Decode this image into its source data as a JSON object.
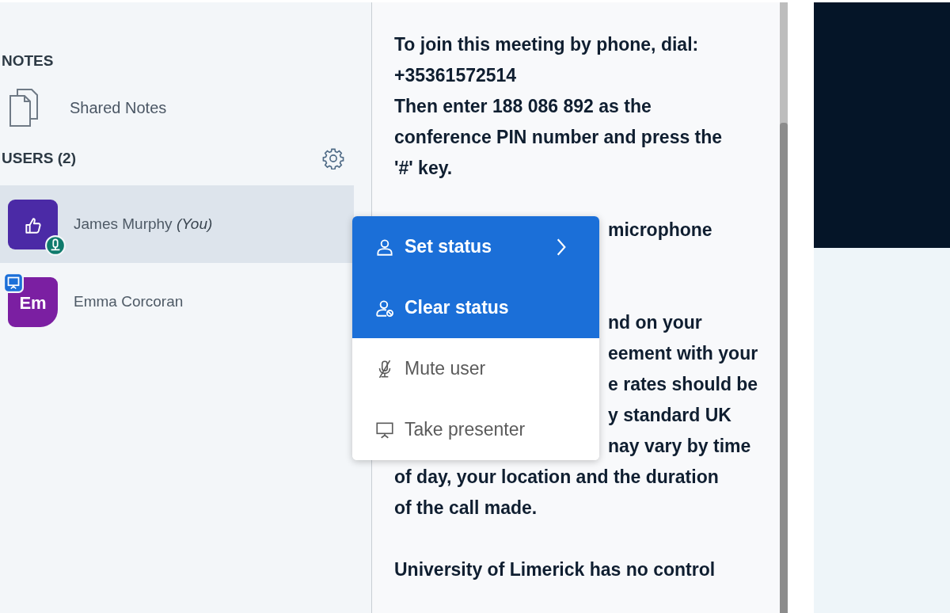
{
  "sidebar": {
    "notes": {
      "title": "NOTES",
      "items": [
        {
          "label": "Shared Notes"
        }
      ]
    },
    "users": {
      "title": "USERS (2)",
      "list": [
        {
          "name": "James Murphy",
          "suffix": "(You)",
          "selected": true,
          "avatar": {
            "kind": "status",
            "color": "#4b2aa6"
          },
          "badge": {
            "kind": "voice"
          }
        },
        {
          "name": "Emma Corcoran",
          "selected": false,
          "avatar": {
            "kind": "initials",
            "text": "Em",
            "color": "#7b1fa2"
          },
          "badge": {
            "kind": "presenter"
          }
        }
      ]
    }
  },
  "context_menu": {
    "items": [
      {
        "label": "Set status",
        "kind": "set_status",
        "highlighted": true
      },
      {
        "label": "Clear status",
        "kind": "clear_status",
        "highlighted": true
      },
      {
        "label": "Mute user",
        "kind": "mute",
        "highlighted": false
      },
      {
        "label": "Take presenter",
        "kind": "presenter",
        "highlighted": false
      }
    ]
  },
  "chat": {
    "lines": [
      {
        "kind": "text",
        "text": "To join this meeting by phone, dial:"
      },
      {
        "kind": "text",
        "text": "+35361572514"
      },
      {
        "kind": "text",
        "text": "Then enter 188 086 892 as the"
      },
      {
        "kind": "text",
        "text": "conference PIN number and press the"
      },
      {
        "kind": "text",
        "text": "'#' key."
      },
      {
        "kind": "blank"
      },
      {
        "kind": "tail",
        "text": "microphone"
      },
      {
        "kind": "blank"
      },
      {
        "kind": "blank"
      },
      {
        "kind": "tail",
        "text": "nd on your"
      },
      {
        "kind": "tail",
        "text": "eement with your"
      },
      {
        "kind": "tail",
        "text": "e rates should be"
      },
      {
        "kind": "tail",
        "text": "y standard UK"
      },
      {
        "kind": "tail",
        "text": "nay vary by time"
      },
      {
        "kind": "text",
        "text": "of day, your location and the duration"
      },
      {
        "kind": "text",
        "text": "of the call made."
      },
      {
        "kind": "blank"
      },
      {
        "kind": "text",
        "text": "University of Limerick has no control"
      }
    ]
  }
}
